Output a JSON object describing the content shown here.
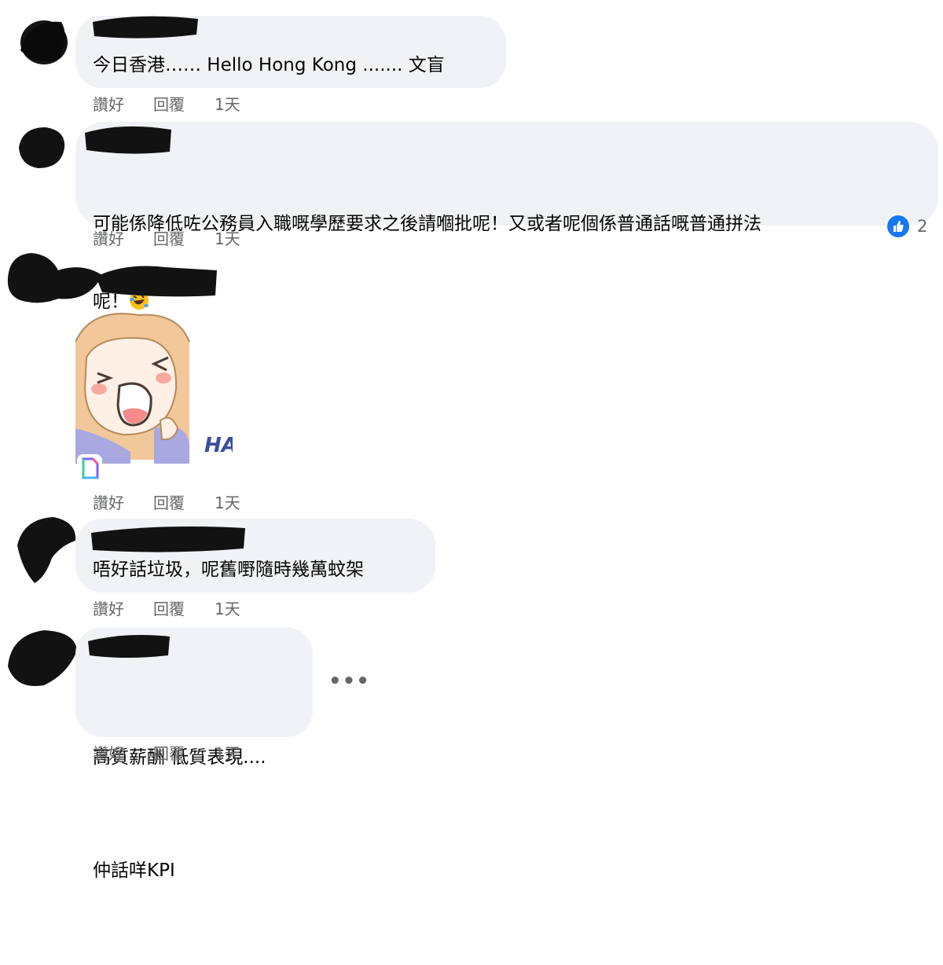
{
  "comments": [
    {
      "text": "今日香港…… Hello Hong Kong ....... 文盲",
      "actions": {
        "like": "讚好",
        "reply": "回覆",
        "time": "1天"
      }
    },
    {
      "text_line1": "可能係降低咗公務員入職嘅學歷要求之後請嗰批呢！又或者呢個係普通話嘅普通拼法",
      "text_line2": "呢！",
      "emoji": "rolling-on-floor-laughing",
      "actions": {
        "like": "讚好",
        "reply": "回覆",
        "time": "1天"
      },
      "reaction": {
        "type": "like",
        "count": "2",
        "color": "#1877f2"
      }
    },
    {
      "sticker": "laughing-girl-sticker",
      "sticker_text": "HA",
      "actions": {
        "like": "讚好",
        "reply": "回覆",
        "time": "1天"
      }
    },
    {
      "text": "唔好話垃圾，呢舊嘢隨時幾萬蚊架",
      "actions": {
        "like": "讚好",
        "reply": "回覆",
        "time": "1天"
      }
    },
    {
      "text_line1": "高質薪酬 低質表現....",
      "text_line2": "仲話咩KPI",
      "more": "•••",
      "actions": {
        "like": "讚好",
        "reply": "回覆",
        "time": "1天"
      }
    }
  ],
  "colors": {
    "bubble": "#f0f2f5",
    "meta": "#65676b",
    "text": "#050505",
    "accent": "#1877f2"
  }
}
